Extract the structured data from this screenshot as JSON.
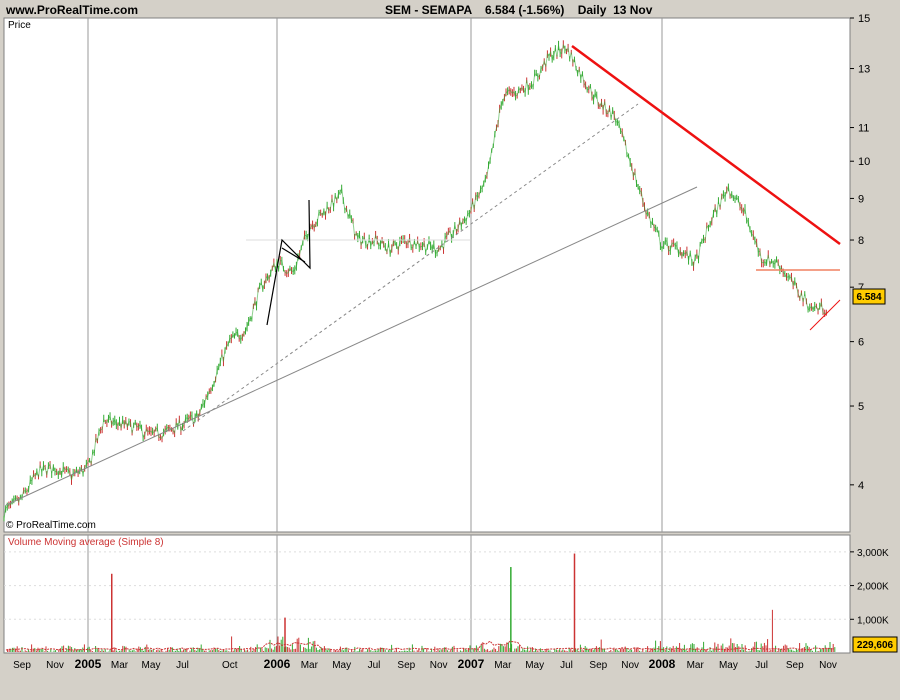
{
  "header": {
    "site": "www.ProRealTime.com",
    "title": "SEM - SEMAPA    6.584 (-1.56%)    Daily  13 Nov"
  },
  "price_panel": {
    "label": "Price",
    "watermark": "© ProRealTime.com",
    "last_price": "6.584"
  },
  "volume_panel": {
    "label": "Volume Moving average (Simple 8)",
    "last_volume": "229,606"
  },
  "colors": {
    "up": "#33aa33",
    "down": "#cc3333",
    "trend": "#ee1111",
    "grid": "#bbbbbb",
    "frame": "#d4d0c8"
  },
  "chart_data": [
    {
      "type": "line",
      "title": "SEM - SEMAPA",
      "ylabel": "Price",
      "scale": "log",
      "ylim": [
        3.5,
        15
      ],
      "y_ticks": [
        "4",
        "5",
        "6",
        "7",
        "8",
        "9",
        "10",
        "11",
        "13",
        "15"
      ],
      "x_ticks": [
        "Sep",
        "Nov",
        "2005",
        "Mar",
        "May",
        "Jul",
        "Oct",
        "2006",
        "Mar",
        "May",
        "Jul",
        "Sep",
        "Nov",
        "2007",
        "Mar",
        "May",
        "Jul",
        "Sep",
        "Nov",
        "2008",
        "Mar",
        "May",
        "Jul",
        "Sep",
        "Nov"
      ],
      "x_ticks_bold": [
        "2005",
        "2006",
        "2007",
        "2008"
      ],
      "series": [
        {
          "x": [
            "2004-08",
            "2004-09",
            "2004-10",
            "2004-11",
            "2004-12",
            "2005-01",
            "2005-02",
            "2005-03",
            "2005-04",
            "2005-05",
            "2005-06",
            "2005-07",
            "2005-08",
            "2005-09",
            "2005-10",
            "2005-11",
            "2005-12",
            "2006-01",
            "2006-02",
            "2006-03",
            "2006-04",
            "2006-05",
            "2006-06",
            "2006-07",
            "2006-08",
            "2006-09",
            "2006-10",
            "2006-11",
            "2006-12",
            "2007-01",
            "2007-02",
            "2007-03",
            "2007-04",
            "2007-05",
            "2007-06",
            "2007-07",
            "2007-08",
            "2007-09",
            "2007-10",
            "2007-11",
            "2007-12",
            "2008-01",
            "2008-02",
            "2008-03",
            "2008-04",
            "2008-05",
            "2008-06",
            "2008-07",
            "2008-08",
            "2008-09",
            "2008-10",
            "2008-11"
          ],
          "values": [
            3.7,
            3.85,
            4.15,
            4.2,
            4.1,
            4.2,
            4.8,
            4.75,
            4.7,
            4.6,
            4.65,
            4.75,
            4.85,
            5.4,
            6.0,
            6.2,
            7.0,
            7.5,
            7.3,
            8.3,
            8.7,
            9.1,
            8.0,
            8.0,
            7.8,
            8.0,
            7.9,
            7.8,
            8.2,
            8.7,
            9.5,
            12.0,
            12.2,
            12.6,
            13.5,
            13.8,
            12.7,
            11.8,
            11.4,
            10.0,
            8.7,
            7.9,
            7.8,
            7.5,
            8.5,
            9.3,
            8.6,
            7.6,
            7.5,
            7.0,
            6.6,
            6.6
          ]
        }
      ],
      "annotations": [
        "downtrend resistance line",
        "long-term support line",
        "flag pattern"
      ]
    },
    {
      "type": "bar",
      "title": "Volume Moving average (Simple 8)",
      "ylim": [
        0,
        3500000
      ],
      "y_ticks": [
        "1,000K",
        "2,000K",
        "3,000K"
      ],
      "y_tick_values": [
        1000000,
        2000000,
        3000000
      ],
      "last_value": 229606,
      "spikes": [
        {
          "x": "2005-02",
          "value": 2350000
        },
        {
          "x": "2006-01",
          "value": 1050000
        },
        {
          "x": "2007-03",
          "value": 2550000
        },
        {
          "x": "2007-07",
          "value": 2950000
        }
      ]
    }
  ]
}
